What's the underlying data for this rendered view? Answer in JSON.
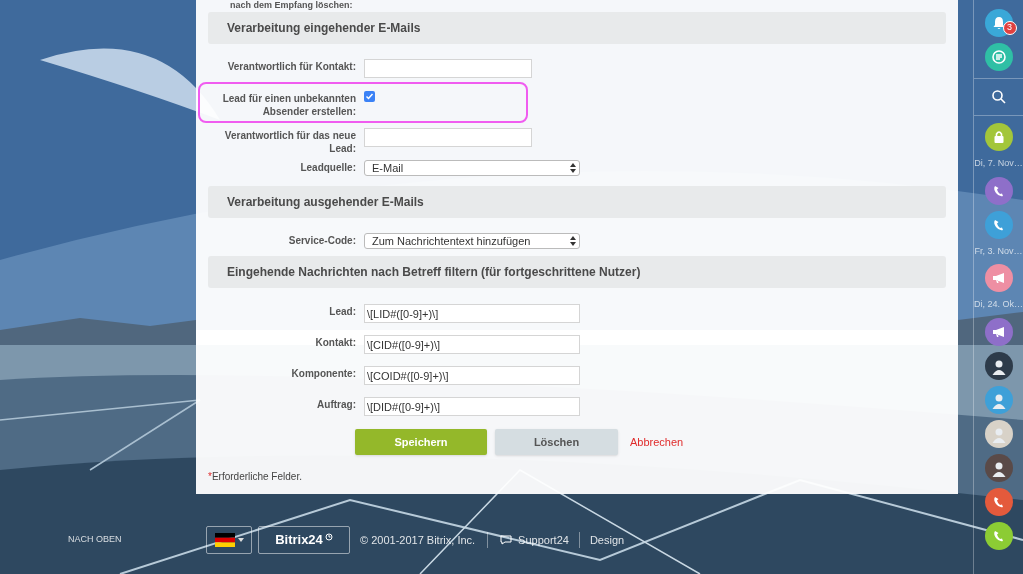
{
  "top_text": "nach dem Empfang löschen:",
  "sections": [
    {
      "title": "Verarbeitung eingehender E-Mails",
      "rows": [
        {
          "kind": "text",
          "label": "Verantwortlich für Kontakt:",
          "value": ""
        },
        {
          "kind": "checkbox",
          "label": "Lead für einen unbekannten Absender erstellen:",
          "checked": true,
          "highlighted": true
        },
        {
          "kind": "text",
          "label": "Verantwortlich für das neue Lead:",
          "value": ""
        },
        {
          "kind": "select",
          "label": "Leadquelle:",
          "value": "E-Mail"
        }
      ]
    },
    {
      "title": "Verarbeitung ausgehender E-Mails",
      "rows": [
        {
          "kind": "select",
          "label": "Service-Code:",
          "value": "Zum Nachrichtentext hinzufügen"
        }
      ]
    },
    {
      "title": "Eingehende Nachrichten nach Betreff filtern (für fortgeschrittene Nutzer)",
      "rows": [
        {
          "kind": "text",
          "label": "Lead:",
          "value": "\\[LID#([0-9]+)\\]"
        },
        {
          "kind": "text",
          "label": "Kontakt:",
          "value": "\\[CID#([0-9]+)\\]"
        },
        {
          "kind": "text",
          "label": "Komponente:",
          "value": "\\[COID#([0-9]+)\\]"
        },
        {
          "kind": "text",
          "label": "Auftrag:",
          "value": "\\[DID#([0-9]+)\\]"
        }
      ]
    }
  ],
  "buttons": {
    "save": "Speichern",
    "delete": "Löschen",
    "cancel": "Abbrechen"
  },
  "required_note": {
    "mark": "*",
    "text": "Erforderliche Felder."
  },
  "sidebar": [
    {
      "kind": "bell",
      "color": "#3aa8d8",
      "badge": "3"
    },
    {
      "kind": "chat",
      "color": "#2fbfa5"
    },
    {
      "kind": "search"
    },
    {
      "kind": "lock",
      "color": "#a3c63a"
    },
    {
      "kind": "date",
      "text": "Di, 7. Nov…"
    },
    {
      "kind": "phone",
      "color": "#8e6fc9"
    },
    {
      "kind": "phone",
      "color": "#3ea0d8"
    },
    {
      "kind": "date",
      "text": "Fr, 3. Nov…"
    },
    {
      "kind": "megaphone",
      "color": "#ee8fa3"
    },
    {
      "kind": "date",
      "text": "Di, 24. Ok…"
    },
    {
      "kind": "megaphone",
      "color": "#8e6fc9"
    },
    {
      "kind": "avatar",
      "color": "#2d3b4a"
    },
    {
      "kind": "avatar",
      "color": "#3ea0d8"
    },
    {
      "kind": "avatar",
      "color": "#d8d2c8"
    },
    {
      "kind": "avatar",
      "color": "#5a4a48"
    },
    {
      "kind": "phone",
      "color": "#e45a3c"
    },
    {
      "kind": "phone",
      "color": "#8ccc34"
    }
  ],
  "footer": {
    "to_top": "NACH OBEN",
    "logo": "Bitrix24",
    "copyright": "© 2001-2017 Bitrix, Inc.",
    "support": "Support24",
    "design": "Design"
  }
}
